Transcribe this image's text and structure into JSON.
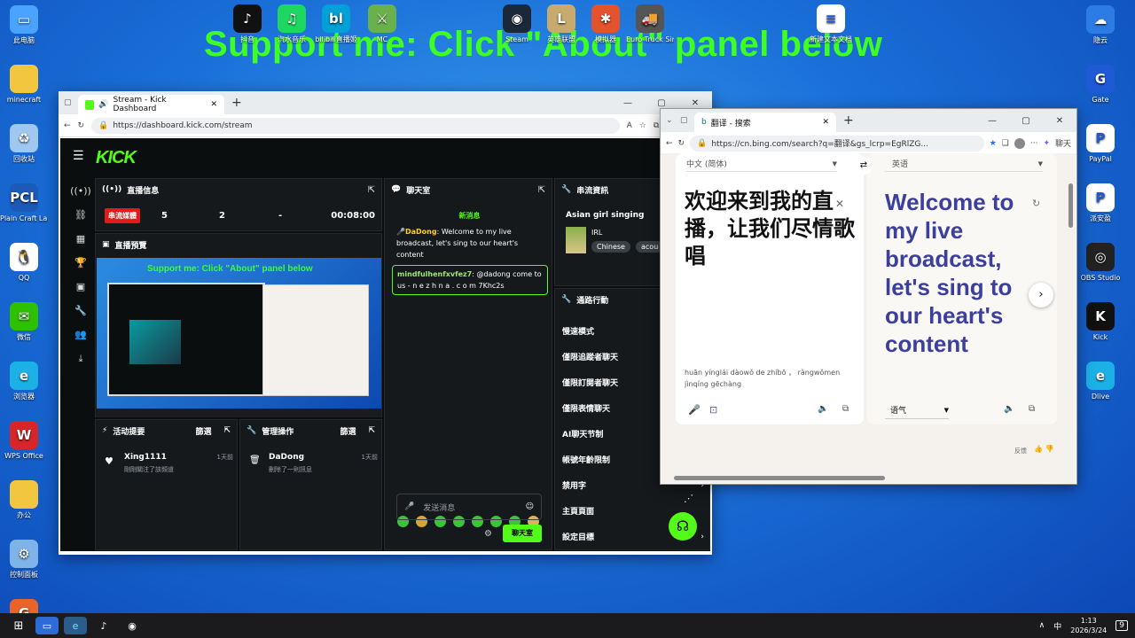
{
  "banner": "Support me: Click \"About\" panel below",
  "desktop_left": [
    {
      "label": "此电脑",
      "icon": "computer-icon",
      "color": "#4aa3ff",
      "glyph": "▭"
    },
    {
      "label": "minecraft",
      "icon": "folder-icon",
      "color": "#f3c640",
      "glyph": ""
    },
    {
      "label": "回收站",
      "icon": "recycle-bin-icon",
      "color": "#9fc7ef",
      "glyph": "♻"
    },
    {
      "label": "Plain Craft Launche...",
      "icon": "pcl-icon",
      "color": "#1d5ab8",
      "glyph": "PCL"
    },
    {
      "label": "QQ",
      "icon": "qq-icon",
      "color": "#ffffff",
      "glyph": "🐧"
    },
    {
      "label": "微信",
      "icon": "wechat-icon",
      "color": "#2dc100",
      "glyph": "✉"
    },
    {
      "label": "浏览器",
      "icon": "edge-icon",
      "color": "#1bb1e6",
      "glyph": "e"
    },
    {
      "label": "WPS Office",
      "icon": "wps-icon",
      "color": "#d7262a",
      "glyph": "W"
    },
    {
      "label": "办公",
      "icon": "folder-icon",
      "color": "#f3c640",
      "glyph": ""
    },
    {
      "label": "控制面板",
      "icon": "control-panel-icon",
      "color": "#7fb4e8",
      "glyph": "⚙"
    },
    {
      "label": "GCC",
      "icon": "gcc-icon",
      "color": "#e8642b",
      "glyph": "G"
    }
  ],
  "desktop_top": [
    {
      "label": "抖音",
      "icon": "tiktok-icon",
      "color": "#111111",
      "glyph": "♪"
    },
    {
      "label": "汽水音乐",
      "icon": "music-icon",
      "color": "#1ed760",
      "glyph": "♫"
    },
    {
      "label": "bilibili直播姬",
      "icon": "bilibili-icon",
      "color": "#00a1d6",
      "glyph": "bl"
    },
    {
      "label": "MC",
      "icon": "mc-icon",
      "color": "#6ab04c",
      "glyph": "⚔"
    },
    {
      "label": "Steam",
      "icon": "steam-icon",
      "color": "#1b2838",
      "glyph": "◉"
    },
    {
      "label": "英雄联盟",
      "icon": "lol-icon",
      "color": "#c8aa6e",
      "glyph": "L"
    },
    {
      "label": "模拟器",
      "icon": "emulator-icon",
      "color": "#e5532d",
      "glyph": "✱"
    },
    {
      "label": "Euro Truck Simulator 2",
      "icon": "truck-icon",
      "color": "#555555",
      "glyph": "🚚"
    },
    {
      "label": "新建文本文档",
      "icon": "text-file-icon",
      "color": "#ffffff",
      "glyph": "≡"
    }
  ],
  "desktop_right": [
    {
      "label": "隐云",
      "icon": "cloud-icon",
      "color": "#2d7be5",
      "glyph": "☁"
    },
    {
      "label": "Gate",
      "icon": "gate-icon",
      "color": "#1e5ad6",
      "glyph": "G"
    },
    {
      "label": "PayPal",
      "icon": "paypal-icon",
      "color": "#ffffff",
      "glyph": "P"
    },
    {
      "label": "派安盈",
      "icon": "payoneer-icon",
      "color": "#ffffff",
      "glyph": "P"
    },
    {
      "label": "OBS Studio",
      "icon": "obs-icon",
      "color": "#222222",
      "glyph": "◎"
    },
    {
      "label": "Kick",
      "icon": "kick-icon",
      "color": "#111111",
      "glyph": "K"
    },
    {
      "label": "Dlive",
      "icon": "edge-icon",
      "color": "#1bb1e6",
      "glyph": "e"
    }
  ],
  "kick_window": {
    "tab_title": "Stream - Kick Dashboard",
    "url": "https://dashboard.kick.com/stream",
    "logo": "KICK",
    "stream_info": {
      "title": "直播信息",
      "badge": "串流媒體",
      "viewers": "5",
      "followers": "2",
      "dash": "-",
      "time": "00:08:00"
    },
    "preview": {
      "title": "直播預覽",
      "banner": "Support me: Click \"About\" panel below"
    },
    "chat": {
      "title": "聊天室",
      "new_label": "新消息",
      "msg1_user": "DaDong",
      "msg1_text": ": Welcome to my live broadcast, let's sing to our heart's content",
      "msg2_user": "mindfulhenfxvfez7",
      "msg2_text": ": @dadong come to us - n e z h n a . c o m 7Khc2s",
      "input_placeholder": "发送消息",
      "send": "聊天室"
    },
    "stream_details": {
      "title": "串流資訊",
      "stream_title": "Asian girl singing",
      "category": "IRL",
      "tag1": "Chinese",
      "tag2": "acou"
    },
    "actions": {
      "title": "通路行動",
      "rows": [
        "慢速模式",
        "僅限追蹤者聊天",
        "僅限訂閱者聊天",
        "僅限表情聊天",
        "AI聊天节制",
        "帳號年齡限制",
        "禁用字",
        "主頁頁面",
        "設定目標"
      ]
    },
    "activity": {
      "title": "活动提要",
      "filter": "篩選",
      "user": "Xing1111",
      "desc": "剛剛關注了該頻道",
      "time": "1天前"
    },
    "moderation": {
      "title": "管理操作",
      "filter": "篩選",
      "user": "DaDong",
      "desc": "刪除了一則訊息",
      "time": "1天前"
    }
  },
  "bing_window": {
    "tab_title": "翻译 - 搜索",
    "url": "https://cn.bing.com/search?q=翻译&gs_lcrp=EgRlZG...",
    "chat_label": "聊天",
    "source_lang": "中文 (简体)",
    "target_lang": "英语",
    "source_text": "欢迎来到我的直播，让我们尽情歌唱",
    "pinyin": "huān yínglái dàowǒ de zhíbō ， ràngwǒmen jìnqíng gēchàng",
    "target_text": "Welcome to my live broadcast, let's sing to our heart's content",
    "tone": "语气",
    "feedback": "反馈"
  },
  "taskbar": {
    "ime": "中",
    "time": "1:13",
    "date": "2026/3/24",
    "notif": "9"
  }
}
